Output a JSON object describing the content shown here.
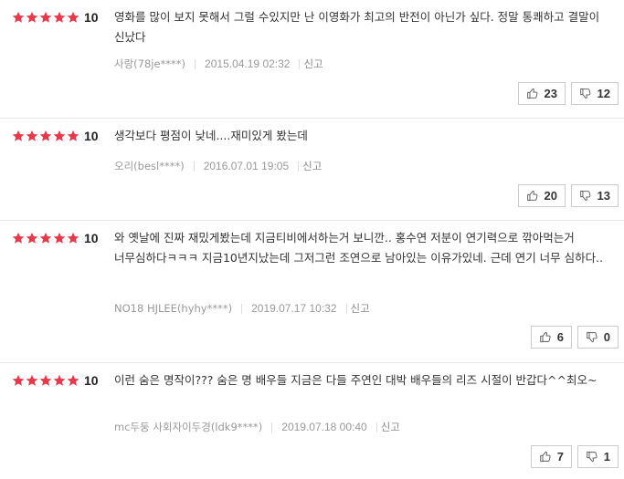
{
  "reviews": [
    {
      "stars": 5,
      "score": "10",
      "text": "영화를 많이 보지 못해서 그럴 수있지만 난 이영화가 최고의 반전이 아닌가 싶다. 정말 통쾌하고 결말이 신났다",
      "user": "사랑(78je****)",
      "date": "2015.04.19 02:32",
      "report": "신고",
      "likes": "23",
      "dislikes": "12"
    },
    {
      "stars": 5,
      "score": "10",
      "text": "생각보다 평점이 낮네....재미있게 봤는데",
      "user": "오리(besl****)",
      "date": "2016.07.01 19:05",
      "report": "신고",
      "likes": "20",
      "dislikes": "13"
    },
    {
      "stars": 5,
      "score": "10",
      "text": "와 옛날에 진짜 재밌게봤는데 지금티비에서하는거 보니깐.. 홍수연 저분이 연기력으로 깎아먹는거 너무심하다ㅋㅋㅋ 지금10년지났는데 그저그런 조연으로 남아있는 이유가있네. 근데 연기 너무 심하다..",
      "user": "NO18 HJLEE(hyhy****)",
      "date": "2019.07.17 10:32",
      "report": "신고",
      "likes": "6",
      "dislikes": "0"
    },
    {
      "stars": 5,
      "score": "10",
      "text": "이런 숨은 명작이??? 숨은 명 배우들 지금은 다들 주연인 대박 배우들의 리즈 시절이 반갑다^^최오~",
      "user": "mc두둥 사회자이두경(ldk9****)",
      "date": "2019.07.18 00:40",
      "report": "신고",
      "likes": "7",
      "dislikes": "1"
    }
  ],
  "colors": {
    "star": "#e8394b",
    "border": "#e8e8e8",
    "meta": "#999999"
  },
  "icons": {
    "like": "thumbs-up-icon",
    "dislike": "thumbs-down-icon",
    "star": "star-icon"
  }
}
